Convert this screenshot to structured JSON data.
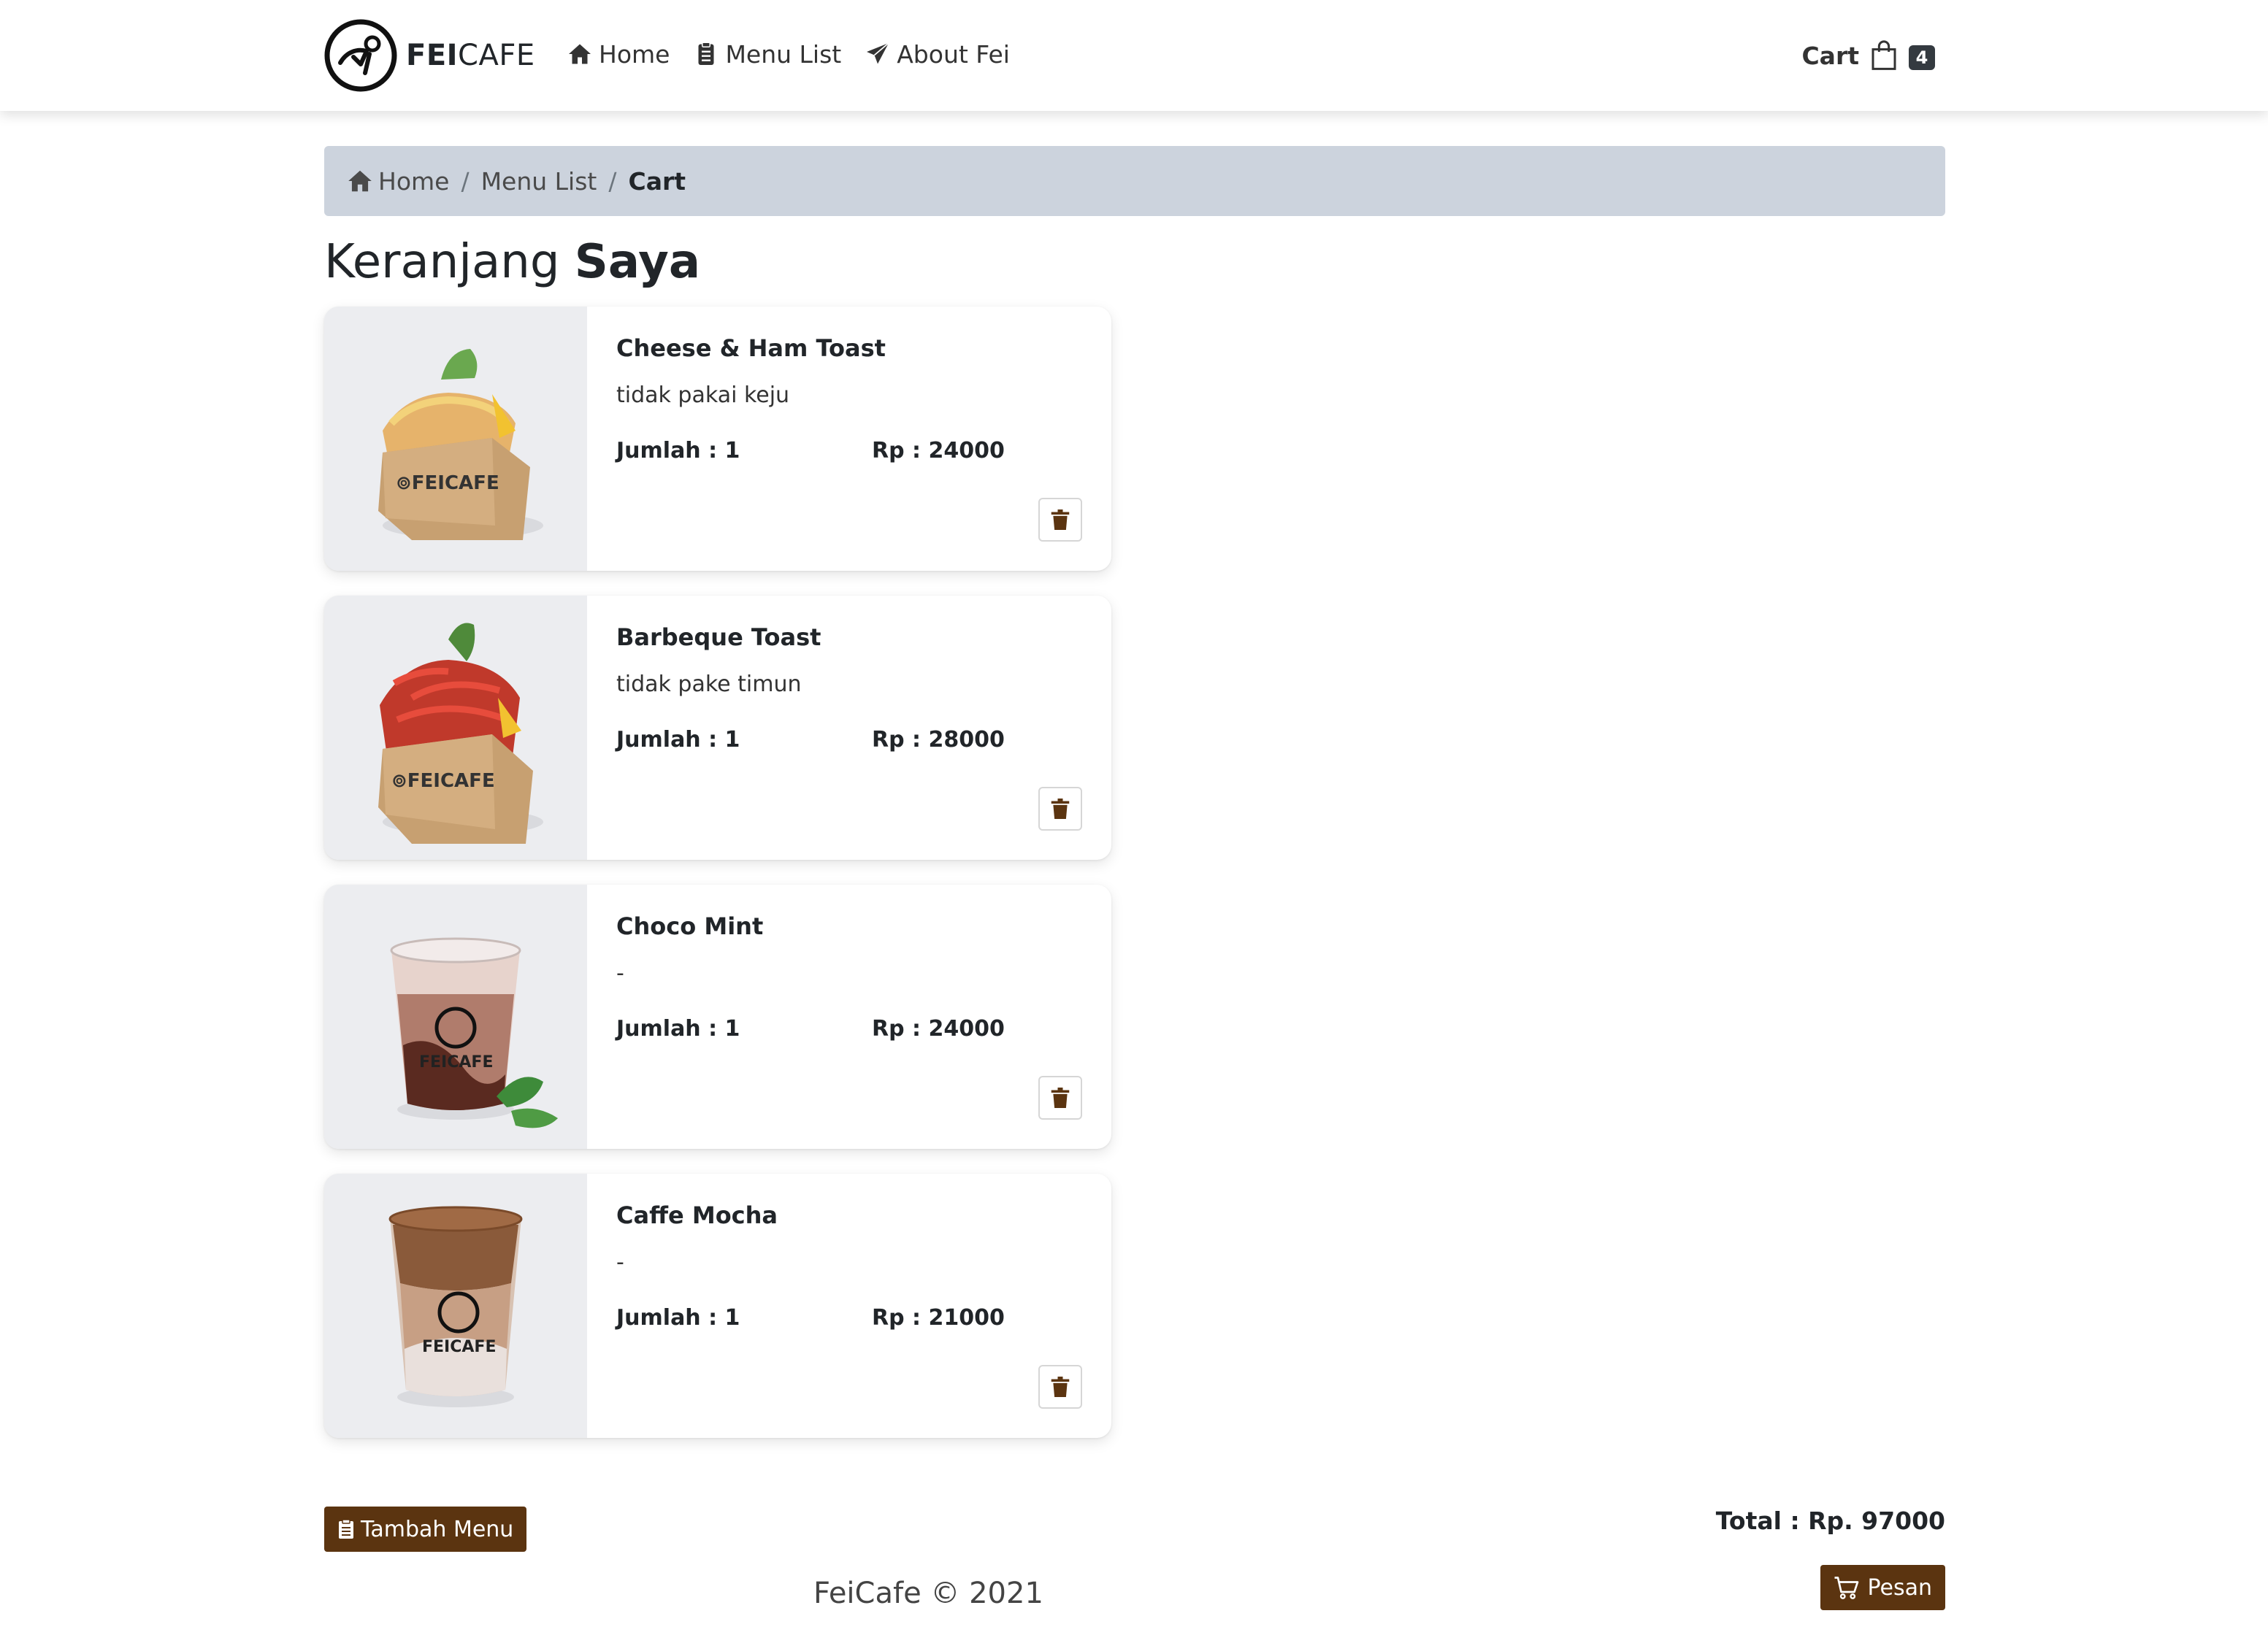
{
  "brand": {
    "name_bold": "FEI",
    "name_rest": "CAFE"
  },
  "nav": {
    "items": [
      {
        "label": "Home",
        "icon": "home-icon"
      },
      {
        "label": "Menu List",
        "icon": "clipboard-icon"
      },
      {
        "label": "About Fei",
        "icon": "paper-plane-icon"
      }
    ],
    "cart_label": "Cart",
    "cart_count": "4"
  },
  "breadcrumb": {
    "items": [
      {
        "label": "Home"
      },
      {
        "label": "Menu List"
      },
      {
        "label": "Cart"
      }
    ],
    "separator": "/"
  },
  "page": {
    "title_light": "Keranjang",
    "title_bold": "Saya"
  },
  "cart_items": [
    {
      "name": "Cheese & Ham Toast",
      "note": "tidak pakai keju",
      "qty": "Jumlah : 1",
      "price": "Rp : 24000",
      "image": "toast-cheese-ham"
    },
    {
      "name": "Barbeque Toast",
      "note": "tidak pake timun",
      "qty": "Jumlah : 1",
      "price": "Rp : 28000",
      "image": "toast-barbeque"
    },
    {
      "name": "Choco Mint",
      "note": "-",
      "qty": "Jumlah : 1",
      "price": "Rp : 24000",
      "image": "drink-choco-mint"
    },
    {
      "name": "Caffe Mocha",
      "note": "-",
      "qty": "Jumlah : 1",
      "price": "Rp : 21000",
      "image": "drink-caffe-mocha"
    }
  ],
  "actions": {
    "add_menu_label": "Tambah Menu",
    "total_label": "Total : Rp. 97000",
    "order_label": "Pesan"
  },
  "footer": {
    "text": "FeiCafe © 2021"
  },
  "colors": {
    "accent": "#5b3410",
    "breadcrumb_bg": "#ccd3dd",
    "badge_bg": "#343a40"
  }
}
